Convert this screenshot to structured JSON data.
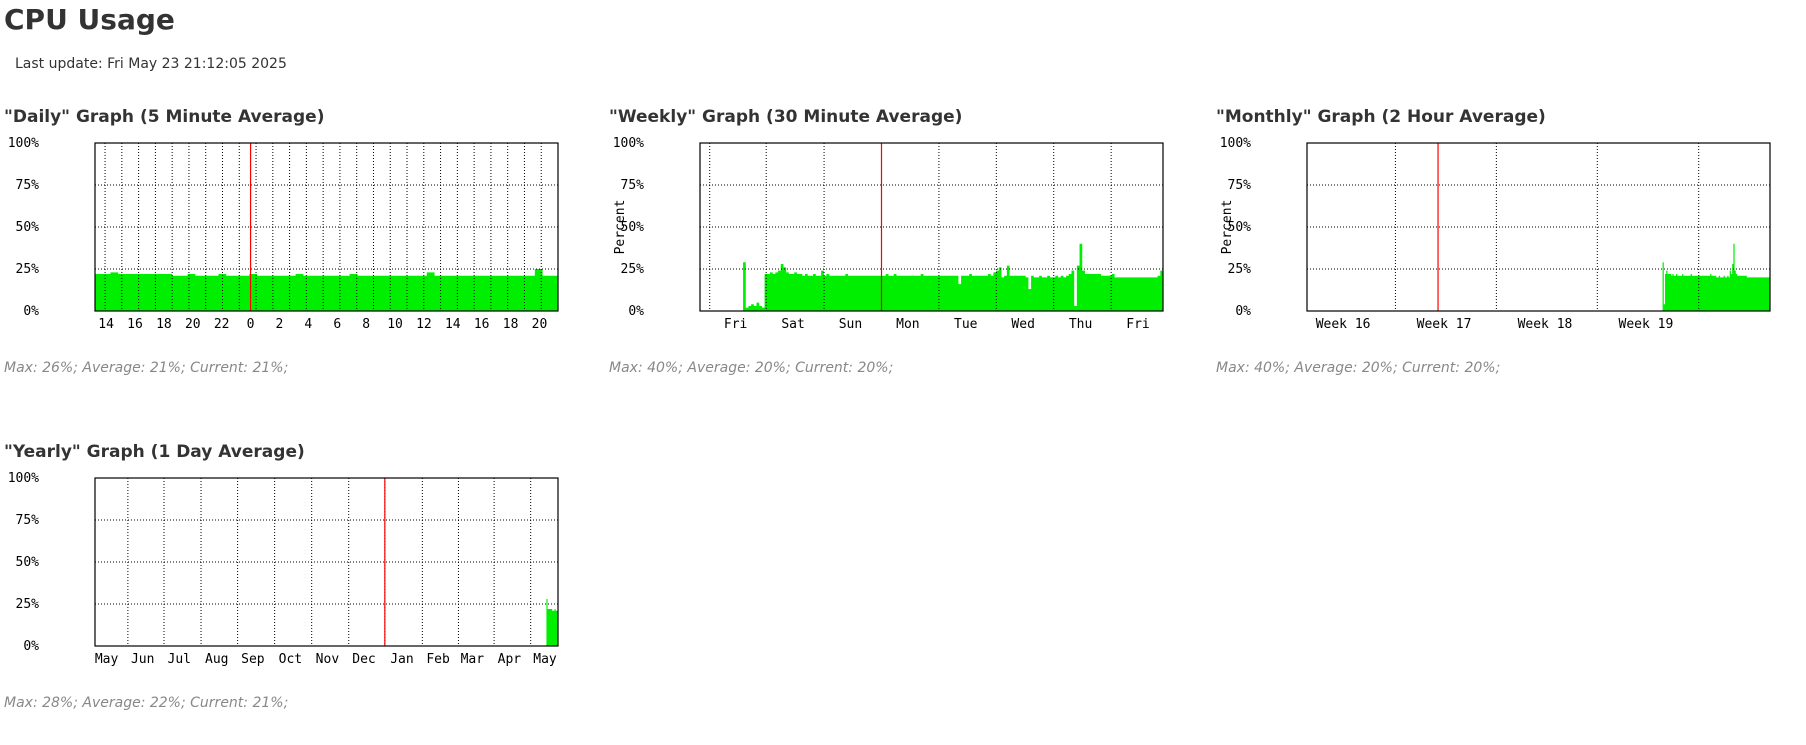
{
  "page": {
    "title": "CPU Usage",
    "last_update": "Last update: Fri May 23 21:12:05 2025"
  },
  "colors": {
    "fill": "#00ee00",
    "edge": "#00cc00",
    "now": "#ff0000",
    "grid": "#000000"
  },
  "chart_data": [
    {
      "type": "area",
      "title": "\"Daily\" Graph (5 Minute Average)",
      "ylabel": "",
      "ylim": [
        0,
        100
      ],
      "y_ticks": [
        "0%",
        "25%",
        "50%",
        "75%",
        "100%"
      ],
      "x_range_hours": [
        -27.6,
        0
      ],
      "x_tick_labels": [
        "14",
        "16",
        "18",
        "20",
        "22",
        "0",
        "2",
        "4",
        "6",
        "8",
        "10",
        "12",
        "14",
        "16",
        "18",
        "20"
      ],
      "x_tick_hours": [
        -21.2,
        -19.2,
        -17.2,
        -15.2,
        -13.2,
        -11.2,
        -9.2,
        -7.2,
        -5.2,
        -3.2,
        -1.2,
        0.8,
        2.8,
        4.8,
        6.8,
        8.8
      ],
      "minor_grid_step": 1,
      "now_marker": "0",
      "series": [
        {
          "values": [
            22,
            22,
            23,
            22,
            22,
            22,
            22,
            22,
            22,
            22,
            21,
            21,
            22,
            21,
            21,
            21,
            22,
            21,
            21,
            21,
            22,
            21,
            21,
            21,
            21,
            21,
            22,
            21,
            21,
            21,
            21,
            21,
            21,
            22,
            21,
            21,
            21,
            21,
            21,
            21,
            21,
            21,
            21,
            23,
            21,
            21,
            21,
            21,
            21,
            21,
            21,
            21,
            21,
            21,
            21,
            21,
            21,
            25,
            21,
            21
          ]
        }
      ],
      "stats": "Max: 26%; Average: 21%; Current: 21%;"
    },
    {
      "type": "area",
      "title": "\"Weekly\" Graph (30 Minute Average)",
      "ylabel": "Percent",
      "ylim": [
        0,
        100
      ],
      "y_ticks": [
        "0%",
        "25%",
        "50%",
        "75%",
        "100%"
      ],
      "x_tick_labels": [
        "Fri",
        "Sat",
        "Sun",
        "Mon",
        "Tue",
        "Wed",
        "Thu",
        "Fri"
      ],
      "now_marker": "Mon",
      "series": [
        {
          "values": [
            0,
            0,
            0,
            0,
            0,
            0,
            0,
            0,
            0,
            0,
            0,
            0,
            0,
            0,
            0,
            0,
            29,
            2,
            3,
            4,
            3,
            5,
            3,
            2,
            22,
            22,
            23,
            22,
            23,
            24,
            28,
            26,
            23,
            22,
            22,
            23,
            22,
            22,
            21,
            22,
            21,
            21,
            22,
            21,
            21,
            24,
            21,
            22,
            21,
            21,
            21,
            21,
            21,
            21,
            22,
            21,
            21,
            21,
            21,
            21,
            21,
            21,
            21,
            21,
            21,
            21,
            21,
            21,
            21,
            22,
            21,
            21,
            22,
            21,
            21,
            21,
            21,
            21,
            21,
            21,
            21,
            21,
            22,
            21,
            21,
            21,
            21,
            21,
            21,
            21,
            21,
            21,
            21,
            21,
            21,
            21,
            16,
            21,
            21,
            21,
            22,
            21,
            21,
            21,
            21,
            21,
            21,
            22,
            21,
            23,
            24,
            26,
            20,
            21,
            27,
            21,
            21,
            21,
            21,
            21,
            21,
            20,
            13,
            21,
            20,
            20,
            21,
            20,
            20,
            21,
            20,
            20,
            21,
            20,
            21,
            20,
            21,
            22,
            24,
            3,
            27,
            40,
            24,
            22,
            22,
            22,
            22,
            22,
            22,
            21,
            21,
            21,
            21,
            22,
            20,
            20,
            20,
            20,
            20,
            20,
            20,
            20,
            20,
            20,
            20,
            20,
            20,
            20,
            20,
            20,
            21,
            24
          ]
        }
      ],
      "stats": "Max: 40%; Average: 20%; Current: 20%;"
    },
    {
      "type": "area",
      "title": "\"Monthly\" Graph (2 Hour Average)",
      "ylabel": "Percent",
      "ylim": [
        0,
        100
      ],
      "y_ticks": [
        "0%",
        "25%",
        "50%",
        "75%",
        "100%"
      ],
      "x_tick_labels": [
        "Week 16",
        "Week 17",
        "Week 18",
        "Week 19"
      ],
      "now_marker": "Week 17",
      "series": [
        {
          "values": [
            29,
            4,
            22,
            24,
            22,
            22,
            22,
            21,
            22,
            21,
            21,
            22,
            21,
            21,
            21,
            21,
            22,
            21,
            21,
            21,
            21,
            21,
            21,
            22,
            21,
            21,
            21,
            21,
            21,
            21,
            21,
            21,
            21,
            21,
            21,
            21,
            21,
            21,
            21,
            22,
            21,
            21,
            21,
            21,
            20,
            20,
            21,
            20,
            20,
            20,
            21,
            20,
            20,
            21,
            20,
            24,
            22,
            28,
            40,
            24,
            22,
            21,
            21,
            21,
            21,
            21,
            21,
            21,
            21,
            20,
            20,
            20,
            20,
            20,
            20,
            20,
            20,
            20,
            20,
            20,
            20,
            20,
            20,
            20,
            20,
            20,
            20,
            20
          ]
        }
      ],
      "stats": "Max: 40%; Average: 20%; Current: 20%;"
    },
    {
      "type": "area",
      "title": "\"Yearly\" Graph (1 Day Average)",
      "ylabel": "",
      "ylim": [
        0,
        100
      ],
      "y_ticks": [
        "0%",
        "25%",
        "50%",
        "75%",
        "100%"
      ],
      "x_tick_labels": [
        "May",
        "Jun",
        "Jul",
        "Aug",
        "Sep",
        "Oct",
        "Nov",
        "Dec",
        "Jan",
        "Feb",
        "Mar",
        "Apr",
        "May"
      ],
      "now_marker": "Jan",
      "series": [
        {
          "values": [
            28,
            22,
            22,
            22,
            22,
            21,
            21,
            22,
            21,
            21
          ]
        }
      ],
      "stats": "Max: 28%; Average: 22%; Current: 21%;"
    }
  ]
}
